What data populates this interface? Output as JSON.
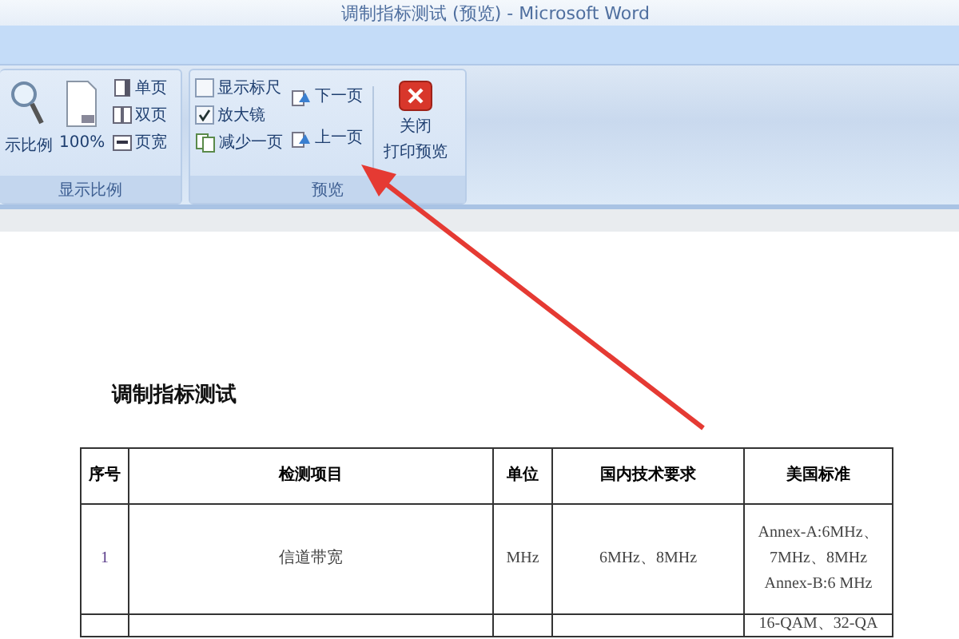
{
  "window": {
    "title": "调制指标测试 (预览) - Microsoft Word"
  },
  "zoom_group": {
    "label": "显示比例",
    "zoom_button": {
      "label": "示比例"
    },
    "percent_button": {
      "label": "100%"
    },
    "page_buttons": [
      {
        "label": "单页"
      },
      {
        "label": "双页"
      },
      {
        "label": "页宽"
      }
    ]
  },
  "preview_group": {
    "label": "预览",
    "options": [
      {
        "label": "显示标尺",
        "checked": false
      },
      {
        "label": "放大镜",
        "checked": true
      }
    ],
    "shrink_button": {
      "label": "减少一页"
    },
    "nav_buttons": [
      {
        "label": "下一页"
      },
      {
        "label": "上一页"
      }
    ],
    "close_button": {
      "lines": [
        "关闭",
        "打印预览"
      ]
    }
  },
  "document": {
    "heading": "调制指标测试",
    "table": {
      "columns": [
        "序号",
        "检测项目",
        "单位",
        "国内技术要求",
        "美国标准"
      ],
      "rows": [
        {
          "no": "1",
          "item": "信道带宽",
          "unit": "MHz",
          "domestic": "6MHz、8MHz",
          "us": "Annex-A:6MHz、7MHz、8MHz Annex-B:6 MHz"
        },
        {
          "us": "16-QAM、32-QA"
        }
      ]
    }
  }
}
